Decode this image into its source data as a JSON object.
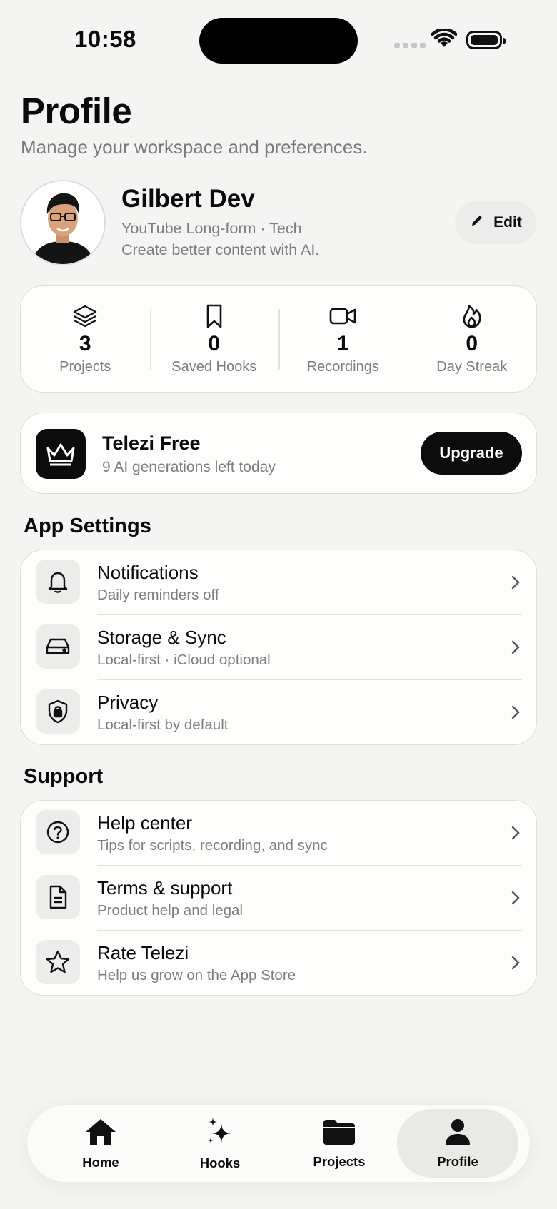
{
  "status_bar": {
    "time": "10:58"
  },
  "header": {
    "title": "Profile",
    "subtitle": "Manage your workspace and preferences."
  },
  "profile": {
    "name": "Gilbert Dev",
    "channel": "YouTube Long-form · Tech",
    "tagline": "Create better content with AI.",
    "edit_label": "Edit"
  },
  "stats": [
    {
      "value": "3",
      "label": "Projects",
      "icon": "layers-icon"
    },
    {
      "value": "0",
      "label": "Saved Hooks",
      "icon": "bookmark-icon"
    },
    {
      "value": "1",
      "label": "Recordings",
      "icon": "video-icon"
    },
    {
      "value": "0",
      "label": "Day Streak",
      "icon": "flame-icon"
    }
  ],
  "plan": {
    "name": "Telezi Free",
    "remaining": "9 AI generations left today",
    "upgrade_label": "Upgrade"
  },
  "app_settings": {
    "heading": "App Settings",
    "items": [
      {
        "title": "Notifications",
        "subtitle": "Daily reminders off",
        "icon": "bell-icon"
      },
      {
        "title": "Storage & Sync",
        "subtitle": "Local-first · iCloud optional",
        "icon": "drive-icon"
      },
      {
        "title": "Privacy",
        "subtitle": "Local-first by default",
        "icon": "shield-lock-icon"
      }
    ]
  },
  "support": {
    "heading": "Support",
    "items": [
      {
        "title": "Help center",
        "subtitle": "Tips for scripts, recording, and sync",
        "icon": "question-icon"
      },
      {
        "title": "Terms & support",
        "subtitle": "Product help and legal",
        "icon": "document-icon"
      },
      {
        "title": "Rate Telezi",
        "subtitle": "Help us grow on the App Store",
        "icon": "star-icon"
      }
    ]
  },
  "tab_bar": {
    "active": "Profile",
    "tabs": [
      {
        "label": "Home",
        "icon": "home-icon"
      },
      {
        "label": "Hooks",
        "icon": "sparkles-icon"
      },
      {
        "label": "Projects",
        "icon": "folder-icon"
      },
      {
        "label": "Profile",
        "icon": "person-icon"
      }
    ]
  },
  "colors": {
    "background": "#f4f4f2",
    "accent": "#0c0c0c",
    "muted_text": "#7d7d7d"
  }
}
